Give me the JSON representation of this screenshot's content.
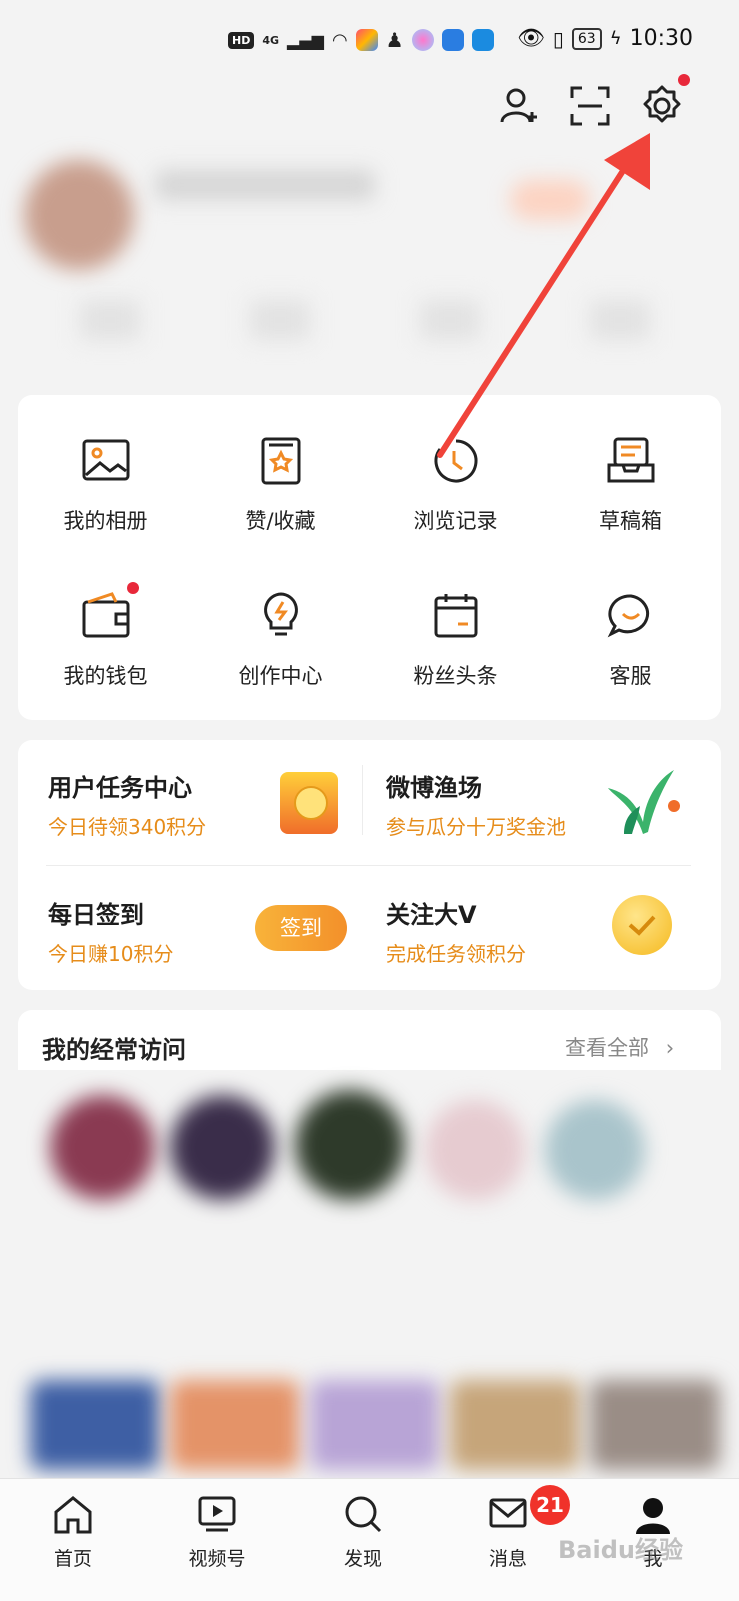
{
  "status_bar": {
    "hd": "HD",
    "net": "4G",
    "battery": "63",
    "time": "10:30"
  },
  "header": {
    "settings_has_dot": true
  },
  "feature_grid": [
    {
      "label": "我的相册",
      "icon": "photo-album-icon"
    },
    {
      "label": "赞/收藏",
      "icon": "bookmark-star-icon"
    },
    {
      "label": "浏览记录",
      "icon": "history-clock-icon"
    },
    {
      "label": "草稿箱",
      "icon": "drafts-tray-icon"
    },
    {
      "label": "我的钱包",
      "icon": "wallet-icon"
    },
    {
      "label": "创作中心",
      "icon": "lightbulb-icon"
    },
    {
      "label": "粉丝头条",
      "icon": "calendar-icon"
    },
    {
      "label": "客服",
      "icon": "chat-smile-icon"
    }
  ],
  "tasks": {
    "user_task_title": "用户任务中心",
    "user_task_sub": "今日待领340积分",
    "fishing_title": "微博渔场",
    "fishing_sub": "参与瓜分十万奖金池",
    "checkin_title": "每日签到",
    "checkin_sub": "今日赚10积分",
    "checkin_button": "签到",
    "follow_title": "关注大V",
    "follow_sub": "完成任务领积分"
  },
  "frequent": {
    "title": "我的经常访问",
    "view_all": "查看全部"
  },
  "tabbar": {
    "home": "首页",
    "video": "视频号",
    "discover": "发现",
    "messages": "消息",
    "messages_badge": "21",
    "me": "我"
  },
  "watermark": "Baidu经验"
}
